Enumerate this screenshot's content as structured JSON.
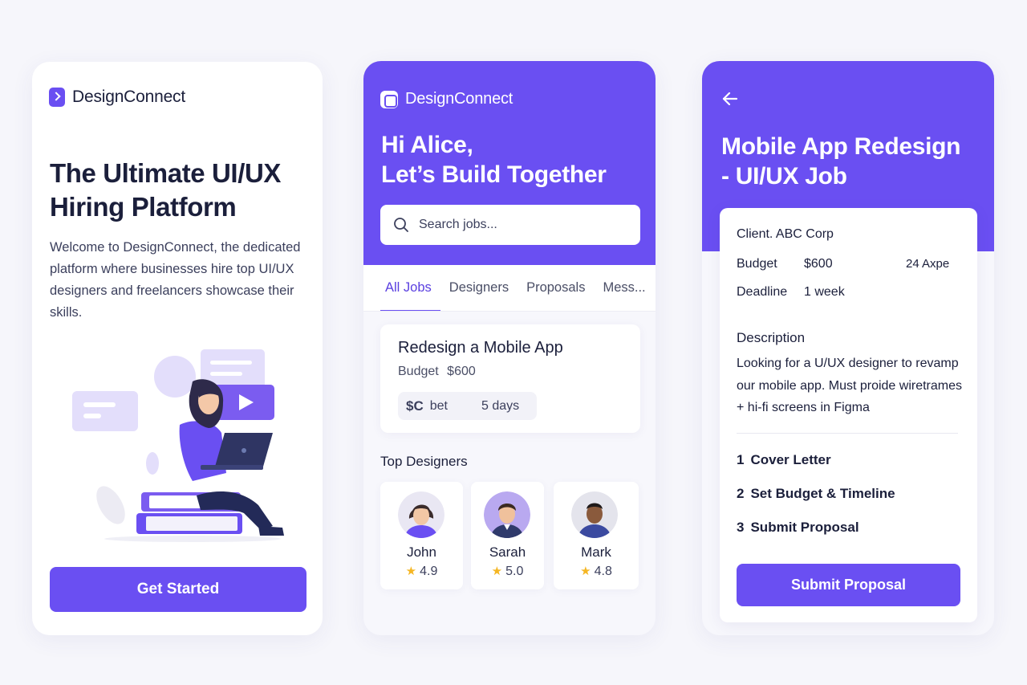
{
  "brand": {
    "name": "DesignConnect"
  },
  "onboarding": {
    "title_line1": "The Ultimate UI/UX",
    "title_line2": "Hiring Platform",
    "description": "Welcome to DesignConnect, the dedicated platform where businesses hire top UI/UX designers and freelancers showcase their skills.",
    "cta": "Get Started"
  },
  "home": {
    "greeting_line1": "Hi Alice,",
    "greeting_line2": "Let’s Build Together",
    "search_placeholder": "Search jobs...",
    "tabs": [
      {
        "label": "All Jobs",
        "active": true
      },
      {
        "label": "Designers",
        "active": false
      },
      {
        "label": "Proposals",
        "active": false
      },
      {
        "label": "Mess...",
        "active": false
      }
    ],
    "job": {
      "title": "Redesign a Mobile App",
      "budget_label": "Budget",
      "budget_value": "$600",
      "chip_symbol": "$C",
      "chip_label": "bet",
      "chip_days": "5 days"
    },
    "top_designers_title": "Top Designers",
    "designers": [
      {
        "name": "John",
        "rating": "4.9",
        "skin": "#f2c7a5",
        "hair": "#3a2b2b",
        "shirt": "#6a4ff2",
        "bg": "#e9e7f3"
      },
      {
        "name": "Sarah",
        "rating": "5.0",
        "skin": "#f0c19c",
        "hair": "#3b2a22",
        "shirt": "#2f3a6b",
        "bg": "#b9a9f0"
      },
      {
        "name": "Mark",
        "rating": "4.8",
        "skin": "#8a5a3c",
        "hair": "#1f1a1a",
        "shirt": "#3b4aa0",
        "bg": "#e4e4ec"
      }
    ]
  },
  "job_detail": {
    "title_line1": "Mobile App Redesign",
    "title_line2": "- UI/UX Job",
    "client": "Client. ABC Corp",
    "budget_label": "Budget",
    "budget_value": "$600",
    "budget_extra": "24 Axpe",
    "deadline_label": "Deadline",
    "deadline_value": "1 week",
    "description_label": "Description",
    "description": "Looking for a U/UX  designer to revamp our mobile app. Must proide wiretrames + hi-fi screens in Figma",
    "steps": [
      {
        "num": "1",
        "label": "Cover Letter"
      },
      {
        "num": "2",
        "label": "Set Budget &  Timeline"
      },
      {
        "num": "3",
        "label": "Submit Proposal"
      }
    ],
    "submit": "Submit Proposal"
  },
  "colors": {
    "accent": "#6a4ff2",
    "background": "#f6f6fb",
    "star": "#f5b623"
  }
}
